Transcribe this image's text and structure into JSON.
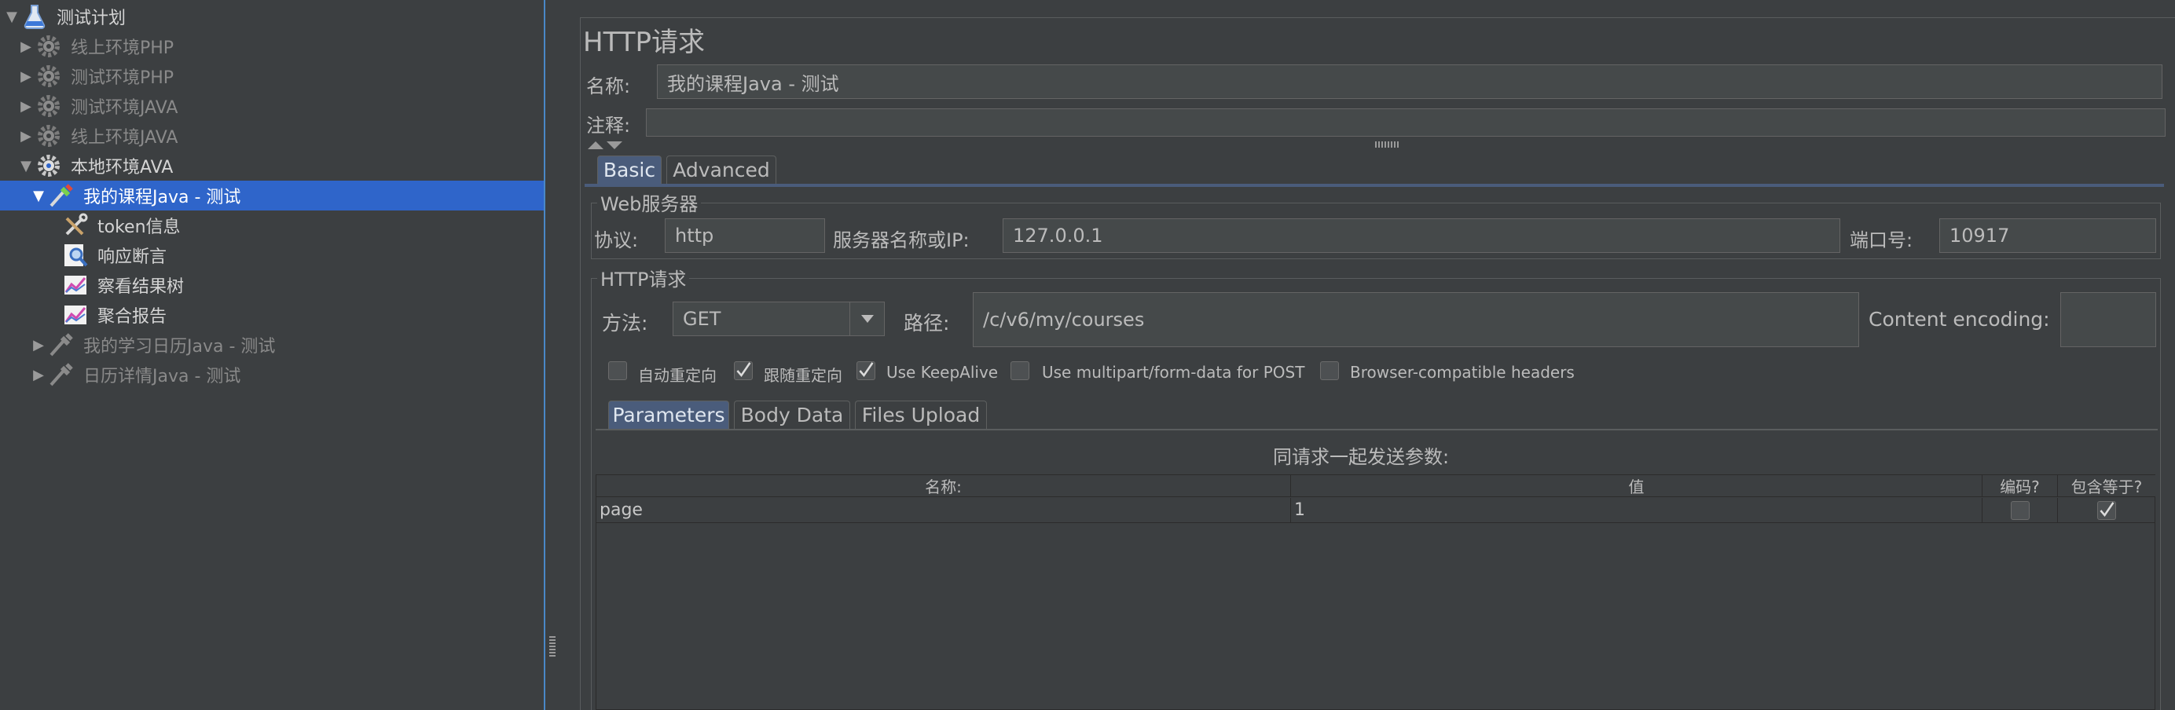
{
  "tree": {
    "items": [
      {
        "label": "测试计划",
        "expanded": true,
        "icon": "test-plan-flask-icon"
      },
      {
        "label": "线上环境PHP",
        "expanded": false,
        "icon": "thread-group-gear-icon",
        "disabled": true
      },
      {
        "label": "测试环境PHP",
        "expanded": false,
        "icon": "thread-group-gear-icon",
        "disabled": true
      },
      {
        "label": "测试环境JAVA",
        "expanded": false,
        "icon": "thread-group-gear-icon",
        "disabled": true
      },
      {
        "label": "线上环境JAVA",
        "expanded": false,
        "icon": "thread-group-gear-icon",
        "disabled": true
      },
      {
        "label": "本地环境AVA",
        "expanded": true,
        "icon": "thread-group-gear-icon"
      },
      {
        "label": "我的课程Java - 测试",
        "expanded": true,
        "icon": "http-sampler-pipette-icon",
        "selected": true
      },
      {
        "label": "token信息",
        "icon": "extractor-tools-icon"
      },
      {
        "label": "响应断言",
        "icon": "assertion-magnifier-icon"
      },
      {
        "label": "察看结果树",
        "icon": "listener-chart-icon"
      },
      {
        "label": "聚合报告",
        "icon": "listener-chart-icon"
      },
      {
        "label": "我的学习日历Java - 测试",
        "expanded": false,
        "icon": "http-sampler-pipette-icon",
        "disabled": true
      },
      {
        "label": "日历详情Java - 测试",
        "expanded": false,
        "icon": "http-sampler-pipette-icon",
        "disabled": true
      }
    ]
  },
  "panel": {
    "title": "HTTP请求",
    "name_label": "名称:",
    "name_value": "我的课程Java - 测试",
    "comment_label": "注释:",
    "comment_value": "",
    "tabs": [
      "Basic",
      "Advanced"
    ],
    "active_tab": "Basic"
  },
  "web_server": {
    "group_title": "Web服务器",
    "protocol_label": "协议:",
    "protocol_value": "http",
    "server_label": "服务器名称或IP:",
    "server_value": "127.0.0.1",
    "port_label": "端口号:",
    "port_value": "10917"
  },
  "http_request": {
    "group_title": "HTTP请求",
    "method_label": "方法:",
    "method_value": "GET",
    "path_label": "路径:",
    "path_value": "/c/v6/my/courses",
    "encoding_label": "Content encoding:",
    "encoding_value": "",
    "options": [
      {
        "label": "自动重定向",
        "checked": false
      },
      {
        "label": "跟随重定向",
        "checked": true
      },
      {
        "label": "Use KeepAlive",
        "checked": true
      },
      {
        "label": "Use multipart/form-data for POST",
        "checked": false
      },
      {
        "label": "Browser-compatible headers",
        "checked": false
      }
    ]
  },
  "params": {
    "tabs": [
      "Parameters",
      "Body Data",
      "Files Upload"
    ],
    "active_tab": "Parameters",
    "caption": "同请求一起发送参数:",
    "columns": [
      "名称:",
      "值",
      "编码?",
      "包含等于?"
    ],
    "rows": [
      {
        "name": "page",
        "value": "1",
        "encode": false,
        "include_equals": true
      }
    ]
  },
  "colors": {
    "background": "#3c3f41",
    "selection": "#2f65ca",
    "active_tab": "#4a5c7b",
    "field": "#45494a"
  }
}
